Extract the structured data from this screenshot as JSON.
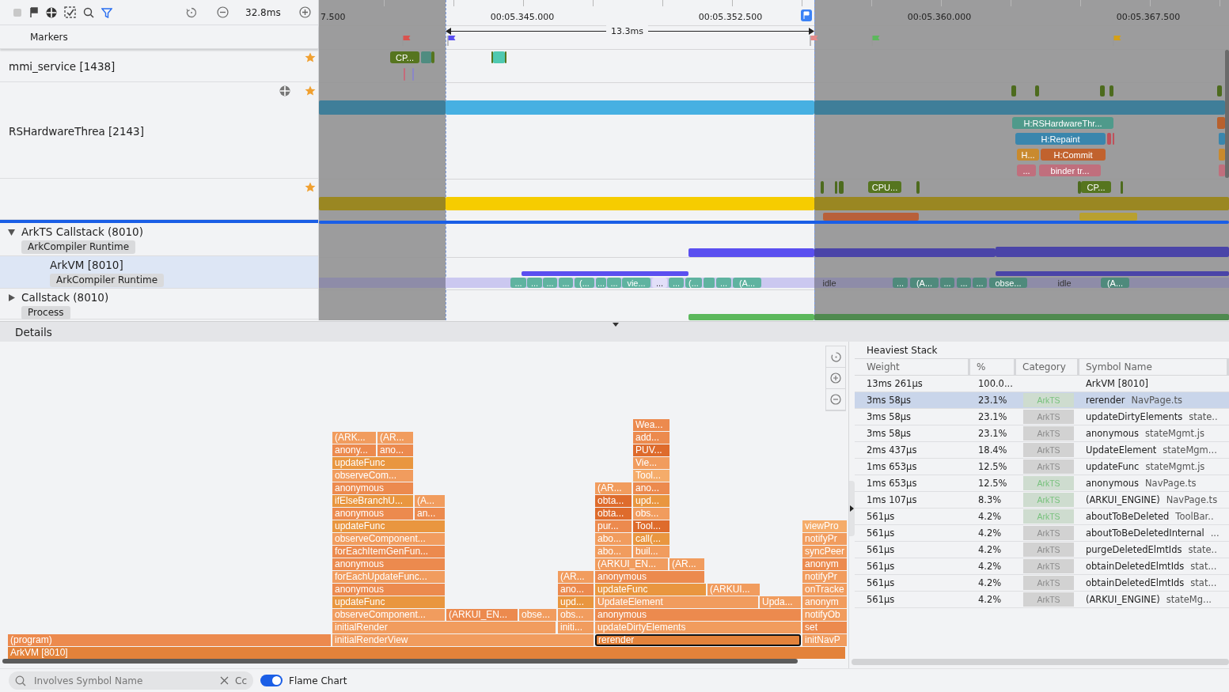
{
  "toolbar": {
    "duration": "32.8ms"
  },
  "timeline": {
    "ticks": [
      "7.500",
      "00:05.345.000",
      "00:05.352.500",
      "00:05.360.000",
      "00:05.367.500"
    ],
    "selection": "13.3ms"
  },
  "tracks": [
    {
      "kind": "markers",
      "label": "Markers",
      "selected": false
    },
    {
      "kind": "thread",
      "label": "mmi_service [1438]",
      "selected": false,
      "slices": [
        "CP..."
      ]
    },
    {
      "kind": "thread",
      "label": "RSHardwareThrea [2143]",
      "selected": false,
      "slices": [
        "H:RSHardwareThr...",
        "H:Repaint",
        "H...",
        "H:Commit",
        "...",
        "binder tr..."
      ]
    },
    {
      "kind": "thread",
      "selected": false,
      "slices": [
        "CPU...",
        "CP..."
      ]
    },
    {
      "kind": "group",
      "label": "ArkTS Callstack (8010)",
      "tag": "ArkCompiler Runtime",
      "expanded": true,
      "selected": false
    },
    {
      "kind": "process",
      "label": "ArkVM [8010]",
      "tag": "ArkCompiler Runtime",
      "selected": true,
      "slices": [
        "...",
        "...",
        "...",
        "...",
        "(...",
        "...",
        "...",
        "vie...",
        "...",
        "...",
        "(...",
        "...",
        "(A...",
        "idle",
        "...",
        "(A...",
        "...",
        "...",
        "...",
        "obse...",
        "idle",
        "(A..."
      ]
    },
    {
      "kind": "group",
      "label": "Callstack (8010)",
      "tag": "Process",
      "expanded": false,
      "selected": false
    }
  ],
  "details": {
    "title": "Details"
  },
  "flame_chart": {
    "frames": [
      {
        "label": "Wea...",
        "selected": false
      },
      {
        "label": "(ARK...",
        "selected": false
      },
      {
        "label": "(AR...",
        "selected": false
      },
      {
        "label": "add...",
        "selected": false
      },
      {
        "label": "anony...",
        "selected": false
      },
      {
        "label": "ano...",
        "selected": false
      },
      {
        "label": "PUV...",
        "selected": false
      },
      {
        "label": "updateFunc",
        "selected": false
      },
      {
        "label": "Vie...",
        "selected": false
      },
      {
        "label": "observeCom...",
        "selected": false
      },
      {
        "label": "Tool...",
        "selected": false
      },
      {
        "label": "anonymous",
        "selected": false
      },
      {
        "label": "(AR...",
        "selected": false
      },
      {
        "label": "ano...",
        "selected": false
      },
      {
        "label": "ifElseBranchU...",
        "selected": false
      },
      {
        "label": "(A...",
        "selected": false
      },
      {
        "label": "obta...",
        "selected": false
      },
      {
        "label": "upd...",
        "selected": false
      },
      {
        "label": "anonymous",
        "selected": false
      },
      {
        "label": "an...",
        "selected": false
      },
      {
        "label": "obta...",
        "selected": false
      },
      {
        "label": "obs...",
        "selected": false
      },
      {
        "label": "updateFunc",
        "selected": false
      },
      {
        "label": "pur...",
        "selected": false
      },
      {
        "label": "Tool...",
        "selected": false
      },
      {
        "label": "viewPro",
        "selected": false
      },
      {
        "label": "observeComponent...",
        "selected": false
      },
      {
        "label": "abo...",
        "selected": false
      },
      {
        "label": "call(...",
        "selected": false
      },
      {
        "label": "notifyPr",
        "selected": false
      },
      {
        "label": "forEachItemGenFun...",
        "selected": false
      },
      {
        "label": "abo...",
        "selected": false
      },
      {
        "label": "buil...",
        "selected": false
      },
      {
        "label": "syncPeer",
        "selected": false
      },
      {
        "label": "anonymous",
        "selected": false
      },
      {
        "label": "(ARKUI_EN...",
        "selected": false
      },
      {
        "label": "(AR...",
        "selected": false
      },
      {
        "label": "anonym",
        "selected": false
      },
      {
        "label": "forEachUpdateFunc...",
        "selected": false
      },
      {
        "label": "(AR...",
        "selected": false
      },
      {
        "label": "anonymous",
        "selected": false
      },
      {
        "label": "notifyPr",
        "selected": false
      },
      {
        "label": "anonymous",
        "selected": false
      },
      {
        "label": "ano...",
        "selected": false
      },
      {
        "label": "updateFunc",
        "selected": false
      },
      {
        "label": "(ARKUI...",
        "selected": false
      },
      {
        "label": "onTracke",
        "selected": false
      },
      {
        "label": "updateFunc",
        "selected": false
      },
      {
        "label": "upd...",
        "selected": false
      },
      {
        "label": "UpdateElement",
        "selected": false
      },
      {
        "label": "Upda...",
        "selected": false
      },
      {
        "label": "anonym",
        "selected": false
      },
      {
        "label": "observeComponent...",
        "selected": false
      },
      {
        "label": "(ARKUI_EN...",
        "selected": false
      },
      {
        "label": "obse...",
        "selected": false
      },
      {
        "label": "obs...",
        "selected": false
      },
      {
        "label": "anonymous",
        "selected": false
      },
      {
        "label": "notifyOb",
        "selected": false
      },
      {
        "label": "initialRender",
        "selected": false
      },
      {
        "label": "initi...",
        "selected": false
      },
      {
        "label": "updateDirtyElements",
        "selected": false
      },
      {
        "label": "set",
        "selected": false
      },
      {
        "label": "(program)",
        "selected": false
      },
      {
        "label": "initialRenderView",
        "selected": false
      },
      {
        "label": "rerender",
        "selected": true
      },
      {
        "label": "initNavP",
        "selected": false
      },
      {
        "label": "ArkVM [8010]",
        "selected": false
      }
    ]
  },
  "heaviest_stack": {
    "title": "Heaviest Stack",
    "columns": [
      "Weight",
      "%",
      "Category",
      "Symbol Name"
    ],
    "rows": [
      {
        "weight": "13ms 261μs",
        "percent": "100.0...",
        "symbol": "ArkVM [8010]",
        "selected": false
      },
      {
        "weight": "3ms 58μs",
        "percent": "23.1%",
        "category": "ArkTS",
        "color": "#79c27e",
        "symbol": "rerender",
        "file": "NavPage.ts",
        "selected": true
      },
      {
        "weight": "3ms 58μs",
        "percent": "23.1%",
        "category": "ArkTS",
        "color": "#8c8c8c",
        "symbol": "updateDirtyElements",
        "file": "state..",
        "selected": false
      },
      {
        "weight": "3ms 58μs",
        "percent": "23.1%",
        "category": "ArkTS",
        "color": "#8c8c8c",
        "symbol": "anonymous",
        "file": "stateMgmt.js",
        "selected": false
      },
      {
        "weight": "2ms 437μs",
        "percent": "18.4%",
        "category": "ArkTS",
        "color": "#8c8c8c",
        "symbol": "UpdateElement",
        "file": "stateMgm...",
        "selected": false
      },
      {
        "weight": "1ms 653μs",
        "percent": "12.5%",
        "category": "ArkTS",
        "color": "#8c8c8c",
        "symbol": "updateFunc",
        "file": "stateMgmt.js",
        "selected": false
      },
      {
        "weight": "1ms 653μs",
        "percent": "12.5%",
        "category": "ArkTS",
        "color": "#79c27e",
        "symbol": "anonymous",
        "file": "NavPage.ts",
        "selected": false
      },
      {
        "weight": "1ms 107μs",
        "percent": "8.3%",
        "category": "ArkTS",
        "color": "#79c27e",
        "symbol": "(ARKUI_ENGINE)",
        "file": "NavPage.ts",
        "selected": false
      },
      {
        "weight": "561μs",
        "percent": "4.2%",
        "category": "ArkTS",
        "color": "#79c27e",
        "symbol": "aboutToBeDeleted",
        "file": "ToolBar..",
        "selected": false
      },
      {
        "weight": "561μs",
        "percent": "4.2%",
        "category": "ArkTS",
        "color": "#8c8c8c",
        "symbol": "aboutToBeDeletedInternal",
        "file": "...",
        "selected": false
      },
      {
        "weight": "561μs",
        "percent": "4.2%",
        "category": "ArkTS",
        "color": "#8c8c8c",
        "symbol": "purgeDeletedElmtIds",
        "file": "state..",
        "selected": false
      },
      {
        "weight": "561μs",
        "percent": "4.2%",
        "category": "ArkTS",
        "color": "#8c8c8c",
        "symbol": "obtainDeletedElmtIds",
        "file": "stat...",
        "selected": false
      },
      {
        "weight": "561μs",
        "percent": "4.2%",
        "category": "ArkTS",
        "color": "#8c8c8c",
        "symbol": "obtainDeletedElmtIds",
        "file": "stat...",
        "selected": false
      },
      {
        "weight": "561μs",
        "percent": "4.2%",
        "category": "ArkTS",
        "color": "#8c8c8c",
        "symbol": "(ARKUI_ENGINE)",
        "file": "stateMg...",
        "selected": false
      }
    ]
  },
  "footer": {
    "search_placeholder": "Involves Symbol Name",
    "case_button": "Cc",
    "toggle": {
      "label": "Flame Chart",
      "on": true
    }
  }
}
